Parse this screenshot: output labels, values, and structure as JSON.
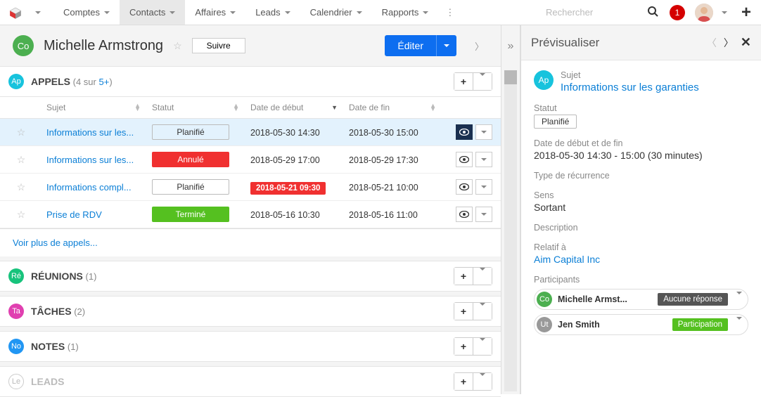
{
  "nav": {
    "items": [
      {
        "label": "Comptes"
      },
      {
        "label": "Contacts",
        "active": true
      },
      {
        "label": "Affaires"
      },
      {
        "label": "Leads"
      },
      {
        "label": "Calendrier"
      },
      {
        "label": "Rapports"
      }
    ],
    "search_placeholder": "Rechercher",
    "notification_count": "1"
  },
  "record": {
    "badge": "Co",
    "title": "Michelle Armstrong",
    "follow_label": "Suivre",
    "edit_label": "Éditer"
  },
  "appels": {
    "badge": "Ap",
    "title": "APPELS",
    "count_text_prefix": "(4 sur ",
    "count_link": "5+",
    "count_text_suffix": ")",
    "columns": {
      "subject": "Sujet",
      "status": "Statut",
      "start": "Date de début",
      "end": "Date de fin"
    },
    "rows": [
      {
        "subject": "Informations sur les...",
        "status": "Planifié",
        "status_style": "plain",
        "start": "2018-05-30 14:30",
        "start_style": "plain",
        "end": "2018-05-30 15:00",
        "selected": true
      },
      {
        "subject": "Informations sur les...",
        "status": "Annulé",
        "status_style": "red",
        "start": "2018-05-29 17:00",
        "start_style": "plain",
        "end": "2018-05-29 17:30"
      },
      {
        "subject": "Informations compl...",
        "status": "Planifié",
        "status_style": "plain",
        "start": "2018-05-21 09:30",
        "start_style": "red",
        "end": "2018-05-21 10:00"
      },
      {
        "subject": "Prise de RDV",
        "status": "Terminé",
        "status_style": "green",
        "start": "2018-05-16 10:30",
        "start_style": "plain",
        "end": "2018-05-16 11:00"
      }
    ],
    "more_link": "Voir plus de appels..."
  },
  "panels": [
    {
      "badge": "Ré",
      "badge_color": "teal",
      "title": "RÉUNIONS",
      "count": "(1)"
    },
    {
      "badge": "Ta",
      "badge_color": "pink",
      "title": "TÂCHES",
      "count": "(2)"
    },
    {
      "badge": "No",
      "badge_color": "blue",
      "title": "NOTES",
      "count": "(1)"
    },
    {
      "badge": "Le",
      "badge_color": "outline",
      "title": "LEADS",
      "count": "",
      "muted": true
    }
  ],
  "preview": {
    "title": "Prévisualiser",
    "badge": "Ap",
    "subject_label": "Sujet",
    "subject_value": "Informations sur les garanties",
    "status_label": "Statut",
    "status_value": "Planifié",
    "daterange_label": "Date de début et de fin",
    "daterange_value": "2018-05-30 14:30 - 15:00 (30 minutes)",
    "recurrence_label": "Type de récurrence",
    "direction_label": "Sens",
    "direction_value": "Sortant",
    "description_label": "Description",
    "related_label": "Relatif à",
    "related_value": "Aim Capital Inc",
    "participants_label": "Participants",
    "participants": [
      {
        "badge": "Co",
        "badge_color": "green",
        "name": "Michelle Armst...",
        "response": "Aucune réponse",
        "resp_color": "grey"
      },
      {
        "badge": "Ut",
        "badge_color": "grey",
        "name": "Jen Smith",
        "response": "Participation",
        "resp_color": "green"
      }
    ]
  }
}
